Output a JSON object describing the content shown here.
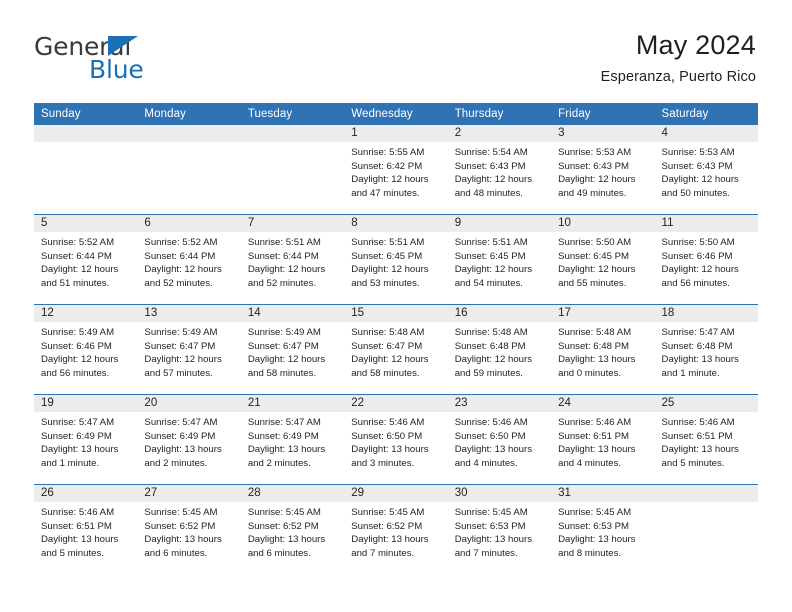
{
  "brand": {
    "name_top": "General",
    "name_bottom": "Blue",
    "triangle_color": "#1c6fb4",
    "text_color": "#3a3a3a"
  },
  "header": {
    "title": "May 2024",
    "subtitle": "Esperanza, Puerto Rico"
  },
  "theme": {
    "header_blue": "#2f73b4",
    "cell_band_gray": "#ececec",
    "text_color": "#231f20"
  },
  "calendar": {
    "weekday_headers": [
      "Sunday",
      "Monday",
      "Tuesday",
      "Wednesday",
      "Thursday",
      "Friday",
      "Saturday"
    ],
    "weeks": [
      [
        {
          "day": "",
          "empty": true,
          "sunrise": "",
          "sunset": "",
          "daylight_1": "",
          "daylight_2": ""
        },
        {
          "day": "",
          "empty": true,
          "sunrise": "",
          "sunset": "",
          "daylight_1": "",
          "daylight_2": ""
        },
        {
          "day": "",
          "empty": true,
          "sunrise": "",
          "sunset": "",
          "daylight_1": "",
          "daylight_2": ""
        },
        {
          "day": "1",
          "empty": false,
          "sunrise": "Sunrise: 5:55 AM",
          "sunset": "Sunset: 6:42 PM",
          "daylight_1": "Daylight: 12 hours",
          "daylight_2": "and 47 minutes."
        },
        {
          "day": "2",
          "empty": false,
          "sunrise": "Sunrise: 5:54 AM",
          "sunset": "Sunset: 6:43 PM",
          "daylight_1": "Daylight: 12 hours",
          "daylight_2": "and 48 minutes."
        },
        {
          "day": "3",
          "empty": false,
          "sunrise": "Sunrise: 5:53 AM",
          "sunset": "Sunset: 6:43 PM",
          "daylight_1": "Daylight: 12 hours",
          "daylight_2": "and 49 minutes."
        },
        {
          "day": "4",
          "empty": false,
          "sunrise": "Sunrise: 5:53 AM",
          "sunset": "Sunset: 6:43 PM",
          "daylight_1": "Daylight: 12 hours",
          "daylight_2": "and 50 minutes."
        }
      ],
      [
        {
          "day": "5",
          "empty": false,
          "sunrise": "Sunrise: 5:52 AM",
          "sunset": "Sunset: 6:44 PM",
          "daylight_1": "Daylight: 12 hours",
          "daylight_2": "and 51 minutes."
        },
        {
          "day": "6",
          "empty": false,
          "sunrise": "Sunrise: 5:52 AM",
          "sunset": "Sunset: 6:44 PM",
          "daylight_1": "Daylight: 12 hours",
          "daylight_2": "and 52 minutes."
        },
        {
          "day": "7",
          "empty": false,
          "sunrise": "Sunrise: 5:51 AM",
          "sunset": "Sunset: 6:44 PM",
          "daylight_1": "Daylight: 12 hours",
          "daylight_2": "and 52 minutes."
        },
        {
          "day": "8",
          "empty": false,
          "sunrise": "Sunrise: 5:51 AM",
          "sunset": "Sunset: 6:45 PM",
          "daylight_1": "Daylight: 12 hours",
          "daylight_2": "and 53 minutes."
        },
        {
          "day": "9",
          "empty": false,
          "sunrise": "Sunrise: 5:51 AM",
          "sunset": "Sunset: 6:45 PM",
          "daylight_1": "Daylight: 12 hours",
          "daylight_2": "and 54 minutes."
        },
        {
          "day": "10",
          "empty": false,
          "sunrise": "Sunrise: 5:50 AM",
          "sunset": "Sunset: 6:45 PM",
          "daylight_1": "Daylight: 12 hours",
          "daylight_2": "and 55 minutes."
        },
        {
          "day": "11",
          "empty": false,
          "sunrise": "Sunrise: 5:50 AM",
          "sunset": "Sunset: 6:46 PM",
          "daylight_1": "Daylight: 12 hours",
          "daylight_2": "and 56 minutes."
        }
      ],
      [
        {
          "day": "12",
          "empty": false,
          "sunrise": "Sunrise: 5:49 AM",
          "sunset": "Sunset: 6:46 PM",
          "daylight_1": "Daylight: 12 hours",
          "daylight_2": "and 56 minutes."
        },
        {
          "day": "13",
          "empty": false,
          "sunrise": "Sunrise: 5:49 AM",
          "sunset": "Sunset: 6:47 PM",
          "daylight_1": "Daylight: 12 hours",
          "daylight_2": "and 57 minutes."
        },
        {
          "day": "14",
          "empty": false,
          "sunrise": "Sunrise: 5:49 AM",
          "sunset": "Sunset: 6:47 PM",
          "daylight_1": "Daylight: 12 hours",
          "daylight_2": "and 58 minutes."
        },
        {
          "day": "15",
          "empty": false,
          "sunrise": "Sunrise: 5:48 AM",
          "sunset": "Sunset: 6:47 PM",
          "daylight_1": "Daylight: 12 hours",
          "daylight_2": "and 58 minutes."
        },
        {
          "day": "16",
          "empty": false,
          "sunrise": "Sunrise: 5:48 AM",
          "sunset": "Sunset: 6:48 PM",
          "daylight_1": "Daylight: 12 hours",
          "daylight_2": "and 59 minutes."
        },
        {
          "day": "17",
          "empty": false,
          "sunrise": "Sunrise: 5:48 AM",
          "sunset": "Sunset: 6:48 PM",
          "daylight_1": "Daylight: 13 hours",
          "daylight_2": "and 0 minutes."
        },
        {
          "day": "18",
          "empty": false,
          "sunrise": "Sunrise: 5:47 AM",
          "sunset": "Sunset: 6:48 PM",
          "daylight_1": "Daylight: 13 hours",
          "daylight_2": "and 1 minute."
        }
      ],
      [
        {
          "day": "19",
          "empty": false,
          "sunrise": "Sunrise: 5:47 AM",
          "sunset": "Sunset: 6:49 PM",
          "daylight_1": "Daylight: 13 hours",
          "daylight_2": "and 1 minute."
        },
        {
          "day": "20",
          "empty": false,
          "sunrise": "Sunrise: 5:47 AM",
          "sunset": "Sunset: 6:49 PM",
          "daylight_1": "Daylight: 13 hours",
          "daylight_2": "and 2 minutes."
        },
        {
          "day": "21",
          "empty": false,
          "sunrise": "Sunrise: 5:47 AM",
          "sunset": "Sunset: 6:49 PM",
          "daylight_1": "Daylight: 13 hours",
          "daylight_2": "and 2 minutes."
        },
        {
          "day": "22",
          "empty": false,
          "sunrise": "Sunrise: 5:46 AM",
          "sunset": "Sunset: 6:50 PM",
          "daylight_1": "Daylight: 13 hours",
          "daylight_2": "and 3 minutes."
        },
        {
          "day": "23",
          "empty": false,
          "sunrise": "Sunrise: 5:46 AM",
          "sunset": "Sunset: 6:50 PM",
          "daylight_1": "Daylight: 13 hours",
          "daylight_2": "and 4 minutes."
        },
        {
          "day": "24",
          "empty": false,
          "sunrise": "Sunrise: 5:46 AM",
          "sunset": "Sunset: 6:51 PM",
          "daylight_1": "Daylight: 13 hours",
          "daylight_2": "and 4 minutes."
        },
        {
          "day": "25",
          "empty": false,
          "sunrise": "Sunrise: 5:46 AM",
          "sunset": "Sunset: 6:51 PM",
          "daylight_1": "Daylight: 13 hours",
          "daylight_2": "and 5 minutes."
        }
      ],
      [
        {
          "day": "26",
          "empty": false,
          "sunrise": "Sunrise: 5:46 AM",
          "sunset": "Sunset: 6:51 PM",
          "daylight_1": "Daylight: 13 hours",
          "daylight_2": "and 5 minutes."
        },
        {
          "day": "27",
          "empty": false,
          "sunrise": "Sunrise: 5:45 AM",
          "sunset": "Sunset: 6:52 PM",
          "daylight_1": "Daylight: 13 hours",
          "daylight_2": "and 6 minutes."
        },
        {
          "day": "28",
          "empty": false,
          "sunrise": "Sunrise: 5:45 AM",
          "sunset": "Sunset: 6:52 PM",
          "daylight_1": "Daylight: 13 hours",
          "daylight_2": "and 6 minutes."
        },
        {
          "day": "29",
          "empty": false,
          "sunrise": "Sunrise: 5:45 AM",
          "sunset": "Sunset: 6:52 PM",
          "daylight_1": "Daylight: 13 hours",
          "daylight_2": "and 7 minutes."
        },
        {
          "day": "30",
          "empty": false,
          "sunrise": "Sunrise: 5:45 AM",
          "sunset": "Sunset: 6:53 PM",
          "daylight_1": "Daylight: 13 hours",
          "daylight_2": "and 7 minutes."
        },
        {
          "day": "31",
          "empty": false,
          "sunrise": "Sunrise: 5:45 AM",
          "sunset": "Sunset: 6:53 PM",
          "daylight_1": "Daylight: 13 hours",
          "daylight_2": "and 8 minutes."
        },
        {
          "day": "",
          "empty": true,
          "sunrise": "",
          "sunset": "",
          "daylight_1": "",
          "daylight_2": ""
        }
      ]
    ]
  }
}
